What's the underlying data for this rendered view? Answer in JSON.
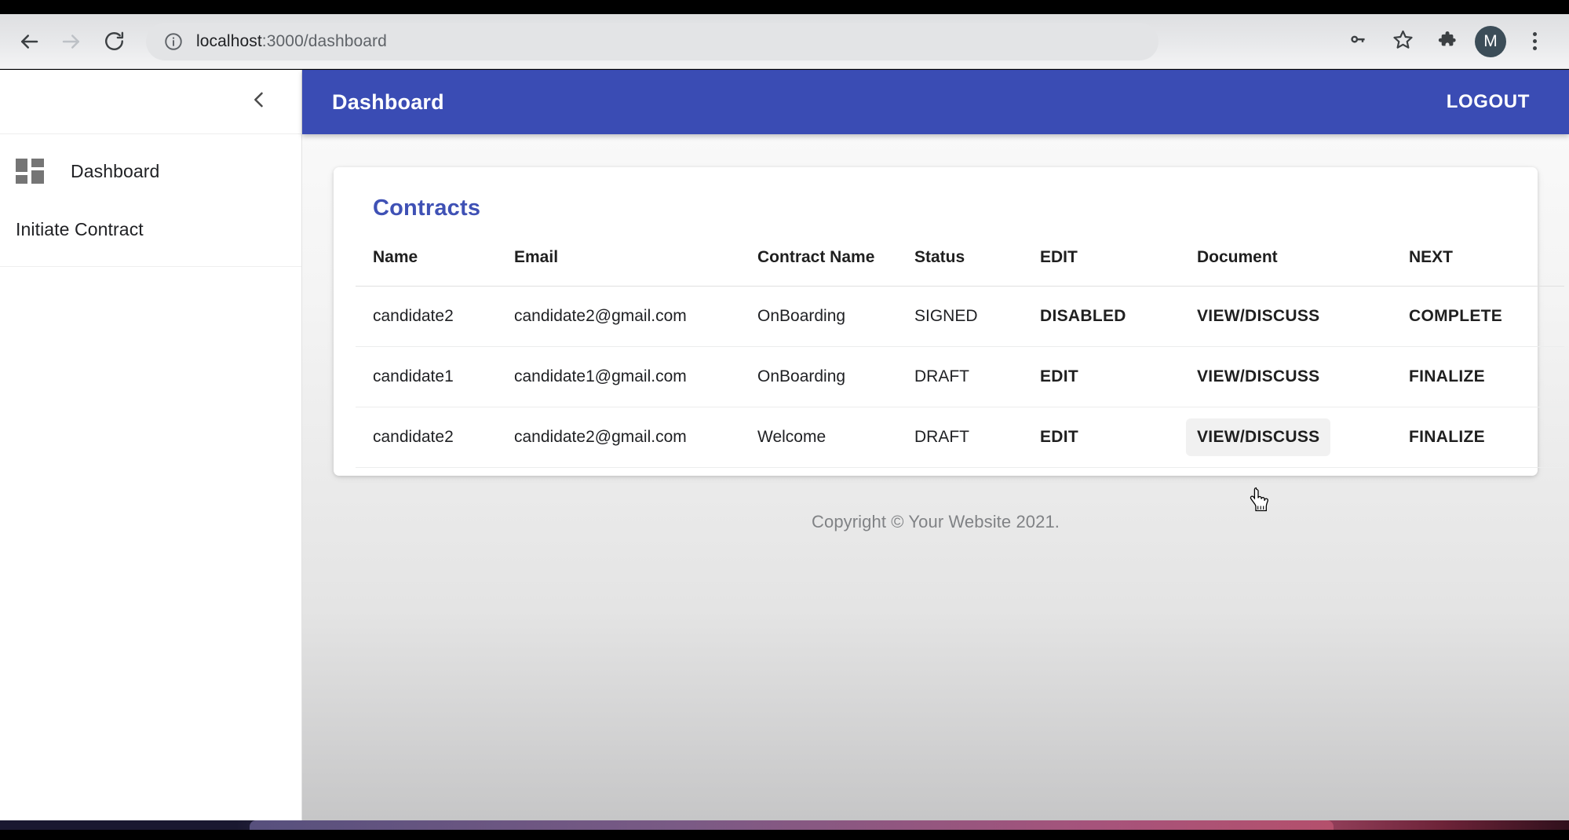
{
  "browser": {
    "back_icon": "arrow-left-icon",
    "forward_icon": "arrow-right-icon",
    "reload_icon": "reload-icon",
    "site_info_icon": "info-circle-icon",
    "url_host": "localhost",
    "url_path": ":3000/dashboard",
    "toolbar_icons": [
      {
        "name": "password-key-icon",
        "glyph": "key"
      },
      {
        "name": "bookmark-star-icon",
        "glyph": "star"
      },
      {
        "name": "extensions-puzzle-icon",
        "glyph": "puzzle"
      }
    ],
    "avatar_letter": "M",
    "menu_icon": "kebab-menu-icon"
  },
  "sidebar": {
    "collapse_icon": "chevron-left-icon",
    "items": [
      {
        "label": "Dashboard",
        "icon": "dashboard-grid-icon"
      },
      {
        "label": "Initiate Contract",
        "icon": ""
      }
    ]
  },
  "appbar": {
    "title": "Dashboard",
    "logout_label": "LOGOUT",
    "background_color": "#3a4cb4"
  },
  "card": {
    "title": "Contracts",
    "title_color": "#3f51b5"
  },
  "table": {
    "columns": [
      "Name",
      "Email",
      "Contract Name",
      "Status",
      "EDIT",
      "Document",
      "NEXT"
    ],
    "rows": [
      {
        "name": "candidate2",
        "email": "candidate2@gmail.com",
        "contract_name": "OnBoarding",
        "status": "SIGNED",
        "edit": "DISABLED",
        "document": "VIEW/DISCUSS",
        "next": "COMPLETE"
      },
      {
        "name": "candidate1",
        "email": "candidate1@gmail.com",
        "contract_name": "OnBoarding",
        "status": "DRAFT",
        "edit": "EDIT",
        "document": "VIEW/DISCUSS",
        "next": "FINALIZE"
      },
      {
        "name": "candidate2",
        "email": "candidate2@gmail.com",
        "contract_name": "Welcome",
        "status": "DRAFT",
        "edit": "EDIT",
        "document": "VIEW/DISCUSS",
        "next": "FINALIZE"
      }
    ]
  },
  "footer": {
    "copyright": "Copyright © Your Website 2021."
  }
}
